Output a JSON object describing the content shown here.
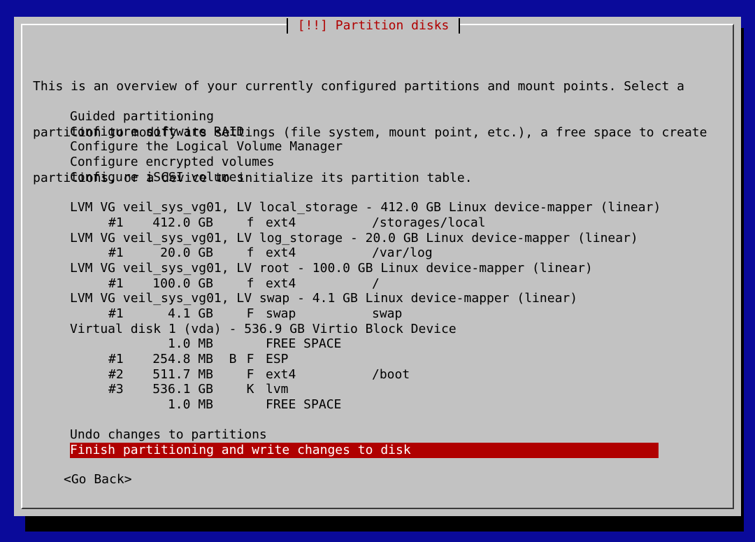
{
  "dialog": {
    "title": "[!!] Partition disks",
    "intro": [
      "This is an overview of your currently configured partitions and mount points. Select a",
      "partition to modify its settings (file system, mount point, etc.), a free space to create",
      "partitions, or a device to initialize its partition table."
    ]
  },
  "menu": {
    "actions": [
      "Guided partitioning",
      "Configure software RAID",
      "Configure the Logical Volume Manager",
      "Configure encrypted volumes",
      "Configure iSCSI volumes"
    ],
    "devices": [
      {
        "label": "LVM VG veil_sys_vg01, LV local_storage - 412.0 GB Linux device-mapper (linear)",
        "partitions": [
          {
            "num": "#1",
            "size": "412.0 GB",
            "bflag": "",
            "flag": "f",
            "fs": "ext4",
            "mount": "/storages/local"
          }
        ]
      },
      {
        "label": "LVM VG veil_sys_vg01, LV log_storage - 20.0 GB Linux device-mapper (linear)",
        "partitions": [
          {
            "num": "#1",
            "size": "20.0 GB",
            "bflag": "",
            "flag": "f",
            "fs": "ext4",
            "mount": "/var/log"
          }
        ]
      },
      {
        "label": "LVM VG veil_sys_vg01, LV root - 100.0 GB Linux device-mapper (linear)",
        "partitions": [
          {
            "num": "#1",
            "size": "100.0 GB",
            "bflag": "",
            "flag": "f",
            "fs": "ext4",
            "mount": "/"
          }
        ]
      },
      {
        "label": "LVM VG veil_sys_vg01, LV swap - 4.1 GB Linux device-mapper (linear)",
        "partitions": [
          {
            "num": "#1",
            "size": "4.1 GB",
            "bflag": "",
            "flag": "F",
            "fs": "swap",
            "mount": "swap"
          }
        ]
      },
      {
        "label": "Virtual disk 1 (vda) - 536.9 GB Virtio Block Device",
        "partitions": [
          {
            "num": "",
            "size": "1.0 MB",
            "bflag": "",
            "flag": "",
            "fs": "FREE SPACE",
            "mount": ""
          },
          {
            "num": "#1",
            "size": "254.8 MB",
            "bflag": "B",
            "flag": "F",
            "fs": "ESP",
            "mount": ""
          },
          {
            "num": "#2",
            "size": "511.7 MB",
            "bflag": "",
            "flag": "F",
            "fs": "ext4",
            "mount": "/boot"
          },
          {
            "num": "#3",
            "size": "536.1 GB",
            "bflag": "",
            "flag": "K",
            "fs": "lvm",
            "mount": ""
          },
          {
            "num": "",
            "size": "1.0 MB",
            "bflag": "",
            "flag": "",
            "fs": "FREE SPACE",
            "mount": ""
          }
        ]
      }
    ],
    "undo": "Undo changes to partitions",
    "finish": "Finish partitioning and write changes to disk",
    "selected_item": "Finish partitioning and write changes to disk"
  },
  "buttons": {
    "go_back": "<Go Back>"
  },
  "colors": {
    "background": "#0a0a9a",
    "dialog": "#c2c2c2",
    "title_text": "#b00000",
    "selection": "#b00000"
  }
}
